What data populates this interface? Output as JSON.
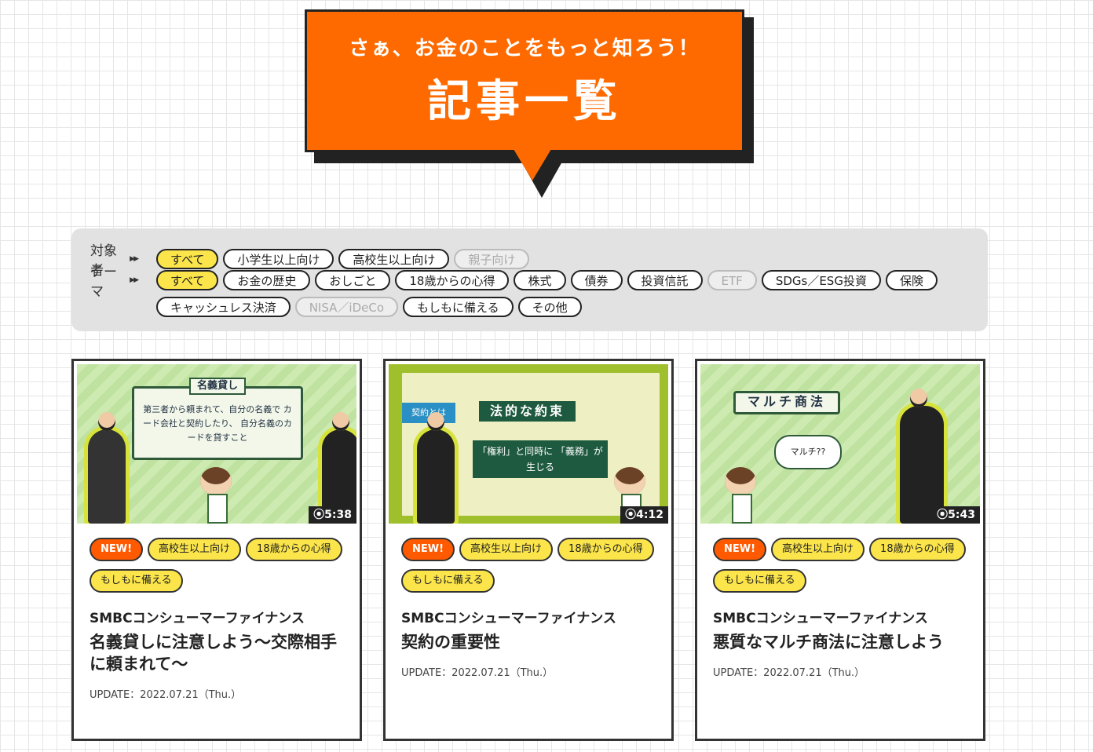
{
  "hero": {
    "subtitle": "さぁ、お金のことをもっと知ろう！",
    "title": "記事一覧"
  },
  "filters": {
    "audience": {
      "label": "対象者",
      "chips": [
        {
          "label": "すべて",
          "state": "active"
        },
        {
          "label": "小学生以上向け",
          "state": "normal"
        },
        {
          "label": "高校生以上向け",
          "state": "normal"
        },
        {
          "label": "親子向け",
          "state": "disabled"
        }
      ]
    },
    "theme": {
      "label": "テーマ",
      "chips": [
        {
          "label": "すべて",
          "state": "active"
        },
        {
          "label": "お金の歴史",
          "state": "normal"
        },
        {
          "label": "おしごと",
          "state": "normal"
        },
        {
          "label": "18歳からの心得",
          "state": "normal"
        },
        {
          "label": "株式",
          "state": "normal"
        },
        {
          "label": "債券",
          "state": "normal"
        },
        {
          "label": "投資信託",
          "state": "normal"
        },
        {
          "label": "ETF",
          "state": "disabled"
        },
        {
          "label": "SDGs／ESG投資",
          "state": "normal"
        },
        {
          "label": "保険",
          "state": "normal"
        },
        {
          "label": "キャッシュレス決済",
          "state": "normal"
        },
        {
          "label": "NISA／iDeCo",
          "state": "disabled"
        },
        {
          "label": "もしもに備える",
          "state": "normal"
        },
        {
          "label": "その他",
          "state": "normal"
        }
      ]
    }
  },
  "articles": [
    {
      "duration": "5:38",
      "board_heading": "名義貸し",
      "board_text": "第三者から頼まれて、自分の名義で カード会社と契約したり、 自分名義のカードを貸すこと",
      "tags": [
        "NEW!",
        "高校生以上向け",
        "18歳からの心得",
        "もしもに備える"
      ],
      "company": "SMBCコンシューマーファイナンス",
      "title": "名義貸しに注意しよう〜交際相手に頼まれて〜",
      "update": "UPDATE：2022.07.21（Thu.）"
    },
    {
      "duration": "4:12",
      "board_heading": "法的な約束",
      "board_label": "契約とは",
      "board_text": "「権利」と同時に 「義務」が生じる",
      "tags": [
        "NEW!",
        "高校生以上向け",
        "18歳からの心得",
        "もしもに備える"
      ],
      "company": "SMBCコンシューマーファイナンス",
      "title": "契約の重要性",
      "update": "UPDATE：2022.07.21（Thu.）"
    },
    {
      "duration": "5:43",
      "board_heading": "マルチ商法",
      "board_text": "マルチ??",
      "tags": [
        "NEW!",
        "高校生以上向け",
        "18歳からの心得",
        "もしもに備える"
      ],
      "company": "SMBCコンシューマーファイナンス",
      "title": "悪質なマルチ商法に注意しよう",
      "update": "UPDATE：2022.07.21（Thu.）"
    }
  ],
  "colors": {
    "accent": "#ff6a00",
    "chip_active": "#fbe54a",
    "new_badge": "#ff5a00"
  }
}
